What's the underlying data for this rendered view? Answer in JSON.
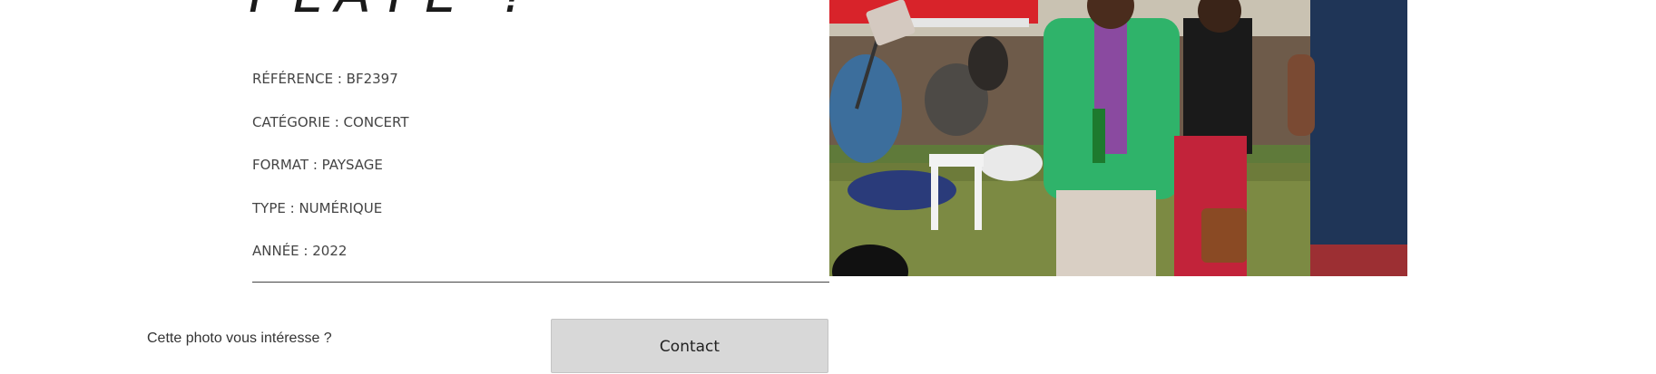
{
  "product": {
    "title": "PLATE  ?",
    "details": [
      {
        "label": "RÉFÉRENCE",
        "value": "BF2397",
        "text": "RÉFÉRENCE : BF2397"
      },
      {
        "label": "CATÉGORIE",
        "value": "CONCERT",
        "text": "CATÉGORIE : CONCERT"
      },
      {
        "label": "FORMAT",
        "value": "PAYSAGE",
        "text": "FORMAT : PAYSAGE"
      },
      {
        "label": "TYPE",
        "value": "NUMÉRIQUE",
        "text": "TYPE : NUMÉRIQUE"
      },
      {
        "label": "ANNÉE",
        "value": "2022",
        "text": "ANNÉE : 2022"
      }
    ]
  },
  "contact_section": {
    "question": "Cette photo vous intéresse ?",
    "button_label": "Contact"
  },
  "colors": {
    "button_bg": "#d8d8d8",
    "text": "#333333",
    "divider": "#444444"
  }
}
